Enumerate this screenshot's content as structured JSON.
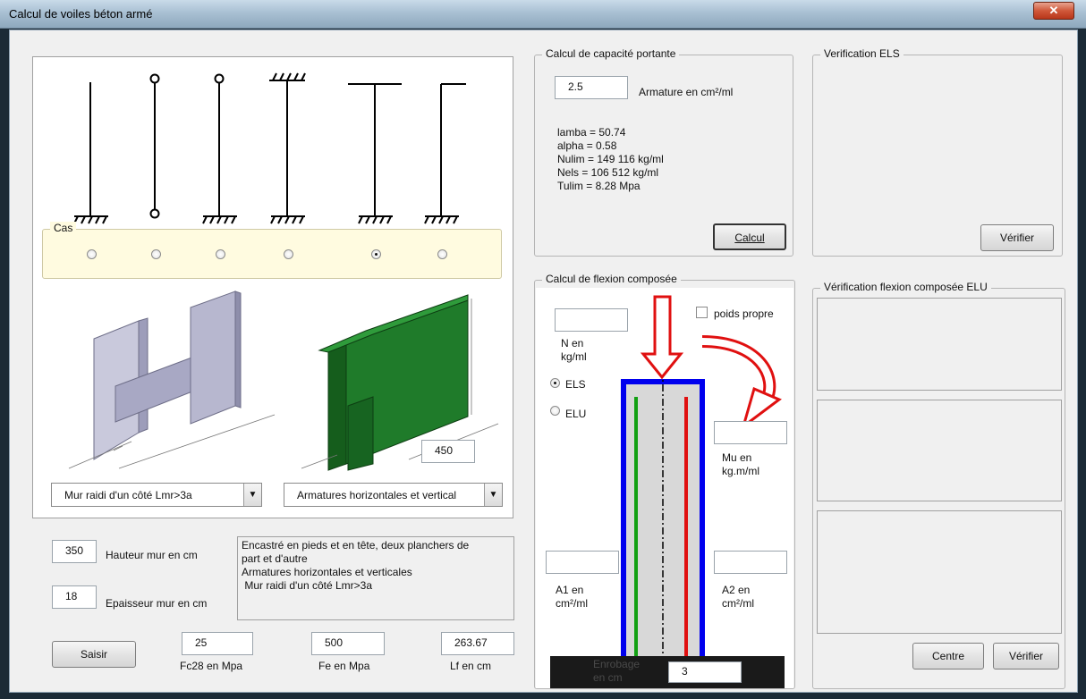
{
  "window": {
    "title": "Calcul de voiles béton armé",
    "close_glyph": "✕"
  },
  "cases": {
    "title": "Cas",
    "selected_index": 4
  },
  "left": {
    "combo_wall": "Mur raidi d'un côté Lmr>3a",
    "combo_rebar": "Armatures horizontales et vertical",
    "length_value": "450",
    "hauteur_value": "350",
    "hauteur_label": "Hauteur mur en cm",
    "epaisseur_value": "18",
    "epaisseur_label": "Epaisseur mur en cm",
    "description": [
      "Encastré en pieds et en tête, deux planchers de",
      "part et d'autre",
      "Armatures horizontales et verticales",
      " Mur raidi d'un côté Lmr>3a"
    ],
    "saisir_label": "Saisir",
    "fc28_value": "25",
    "fc28_label": "Fc28 en Mpa",
    "fe_value": "500",
    "fe_label": "Fe en Mpa",
    "lf_value": "263.67",
    "lf_label": "Lf en cm"
  },
  "capacite": {
    "title": "Calcul de capacité portante",
    "armature_value": "2.5",
    "armature_label": "Armature en cm²/ml",
    "results": [
      "lamba = 50.74",
      "alpha = 0.58",
      "Nulim = 149 116 kg/ml",
      "Nels = 106 512 kg/ml",
      "Tulim = 8.28 Mpa"
    ],
    "calcul_label": "Calcul"
  },
  "els": {
    "title": "Verification ELS",
    "verifier_label": "Vérifier"
  },
  "flexion": {
    "title": "Calcul de flexion composée",
    "n_label_1": "N en",
    "n_label_2": "kg/ml",
    "poids_propre": "poids propre",
    "els_label": "ELS",
    "elu_label": "ELU",
    "mu_label_1": "Mu en",
    "mu_label_2": "kg.m/ml",
    "a1_label_1": "A1 en",
    "a1_label_2": "cm²/ml",
    "a2_label_1": "A2 en",
    "a2_label_2": "cm²/ml",
    "enrobage_label_1": "Enrobage",
    "enrobage_label_2": "en cm",
    "enrobage_value": "3"
  },
  "verif_elu": {
    "title": "Vérification flexion composée ELU",
    "centre_label": "Centre",
    "verifier_label": "Vérifier"
  },
  "colors": {
    "wall_blue": "#0000ee",
    "rebar_green": "#12a012",
    "rebar_red": "#e01010",
    "panel_green": "#1e7a2a",
    "panel_gray": "#b9b9d2"
  }
}
